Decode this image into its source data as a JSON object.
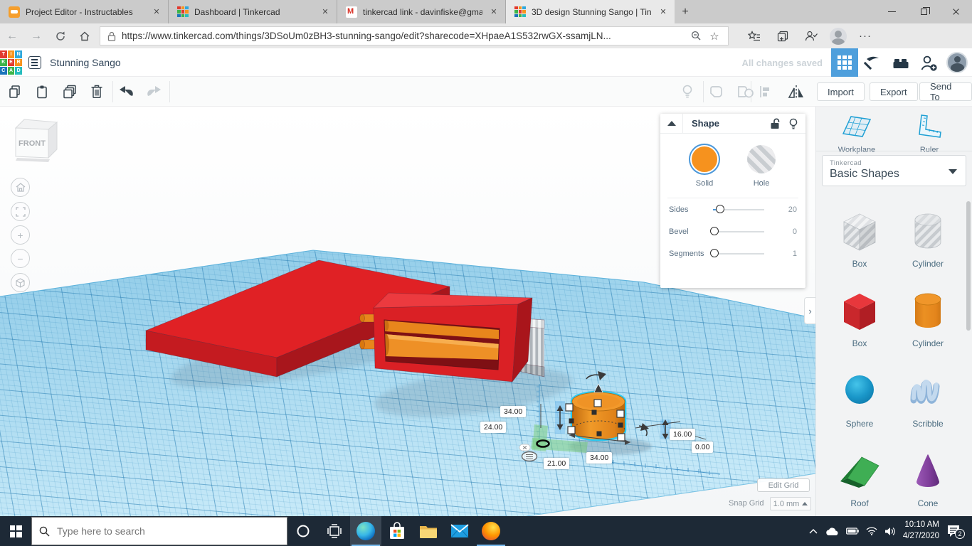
{
  "browser": {
    "tabs": [
      {
        "title": "Project Editor - Instructables",
        "icon": "instructables"
      },
      {
        "title": "Dashboard | Tinkercad",
        "icon": "tinkercad"
      },
      {
        "title": "tinkercad link - davinfiske@gmai",
        "icon": "gmail"
      },
      {
        "title": "3D design Stunning Sango | Tink",
        "icon": "tinkercad"
      }
    ],
    "address": {
      "url": "https://www.tinkercad.com/things/3DSoUm0zBH3-stunning-sango/edit?sharecode=XHpaeA1S532rwGX-ssamjLN..."
    }
  },
  "app_header": {
    "title": "Stunning Sango",
    "save_status": "All changes saved"
  },
  "toolbar": {
    "import_label": "Import",
    "export_label": "Export",
    "send_to_label": "Send To"
  },
  "shape_panel": {
    "title": "Shape",
    "solid_label": "Solid",
    "hole_label": "Hole",
    "sliders": [
      {
        "label": "Sides",
        "value": "20"
      },
      {
        "label": "Bevel",
        "value": "0"
      },
      {
        "label": "Segments",
        "value": "1"
      }
    ]
  },
  "sidebar": {
    "workplane_label": "Workplane",
    "ruler_label": "Ruler",
    "library_brand": "Tinkercad",
    "library_name": "Basic Shapes",
    "shapes": [
      {
        "label": "Box"
      },
      {
        "label": "Cylinder"
      },
      {
        "label": "Box"
      },
      {
        "label": "Cylinder"
      },
      {
        "label": "Sphere"
      },
      {
        "label": "Scribble"
      },
      {
        "label": "Roof"
      },
      {
        "label": "Cone"
      }
    ]
  },
  "viewport": {
    "view_cube_label": "FRONT",
    "edit_grid_label": "Edit Grid",
    "snap_grid_label": "Snap Grid",
    "snap_grid_value": "1.0 mm",
    "dimensions": {
      "d1": "34.00",
      "d2": "24.00",
      "d3": "21.00",
      "d4": "34.00",
      "d5": "16.00",
      "d6": "0.00"
    }
  },
  "taskbar": {
    "search_placeholder": "Type here to search",
    "time": "10:10 AM",
    "date": "4/27/2020",
    "badge": "2"
  },
  "colors": {
    "accent_blue": "#4e9fdc",
    "selection_cyan": "#29c8f0",
    "solid_orange": "#f6921e",
    "shape_red": "#da2025",
    "plane_blue": "#9ed4ee"
  }
}
